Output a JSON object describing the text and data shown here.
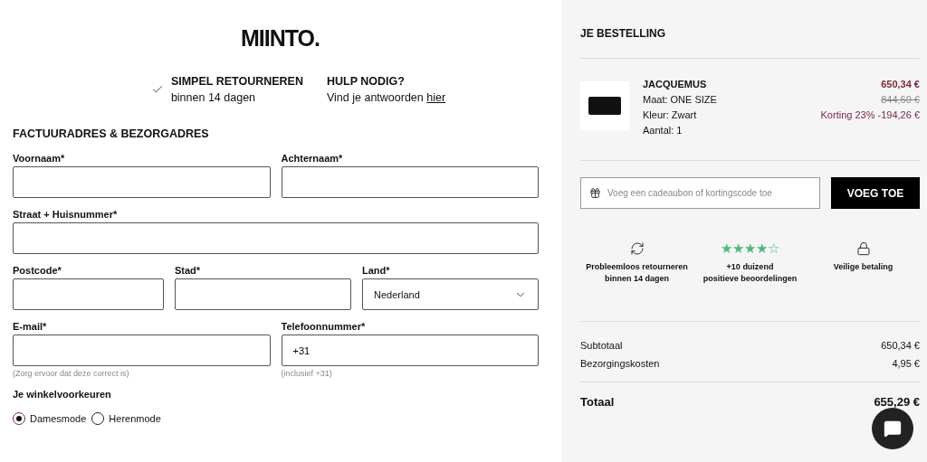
{
  "logo": "MIINTO.",
  "usps": [
    {
      "kind": "check",
      "title": "SIMPEL RETOURNEREN",
      "text": "binnen 14 dagen"
    },
    {
      "kind": "help",
      "title": "HULP NODIG?",
      "text": "Vind je antwoorden",
      "link": "hier"
    }
  ],
  "form": {
    "title": "FACTUURADRES & BEZORGADRES",
    "rows": [
      [
        {
          "label": "Voornaam*",
          "kind": "text"
        },
        {
          "label": "Achternaam*",
          "kind": "text"
        }
      ],
      [
        {
          "label": "Straat + Huisnummer*",
          "kind": "text"
        }
      ],
      [
        {
          "label": "Postcode*",
          "kind": "text"
        },
        {
          "label": "Stad*",
          "kind": "text"
        },
        {
          "label": "Land*",
          "kind": "select",
          "value": "Nederland"
        }
      ],
      [
        {
          "label": "E-mail*",
          "kind": "text",
          "hint": "(Zorg ervoor dat deze correct is)"
        },
        {
          "label": "Telefoonnummer*",
          "kind": "text",
          "value": "+31",
          "hint": "(inclusief +31)"
        }
      ]
    ],
    "preferences": {
      "title": "Je winkelvoorkeuren",
      "options": [
        {
          "label": "Damesmode",
          "selected": true
        },
        {
          "label": "Herenmode",
          "selected": false
        }
      ]
    }
  },
  "order": {
    "title": "JE BESTELLING",
    "item": {
      "brand": "JACQUEMUS",
      "details": [
        "Maat: ONE SIZE",
        "Kleur: Zwart",
        "Aantal: 1"
      ],
      "price": "650,34 €",
      "old_price": "844,60 €",
      "discount": "Korting 23% -194,26 €"
    },
    "voucher": {
      "placeholder": "Voeg een cadeaubon of kortingscode toe",
      "button": "VOEG TOE"
    },
    "benefits": [
      {
        "kind": "returns",
        "lines": [
          "Probleemloos retourneren",
          "binnen 14 dagen"
        ]
      },
      {
        "kind": "rating",
        "stars": 4,
        "lines": [
          "+10 duizend",
          "positieve beoordelingen"
        ]
      },
      {
        "kind": "secure",
        "lines": [
          "Veilige betaling"
        ]
      }
    ],
    "totals": [
      {
        "label": "Subtotaal",
        "value": "650,34 €"
      },
      {
        "label": "Bezorgingskosten",
        "value": "4,95 €"
      }
    ],
    "total": {
      "label": "Totaal",
      "value": "655,29 €"
    }
  }
}
